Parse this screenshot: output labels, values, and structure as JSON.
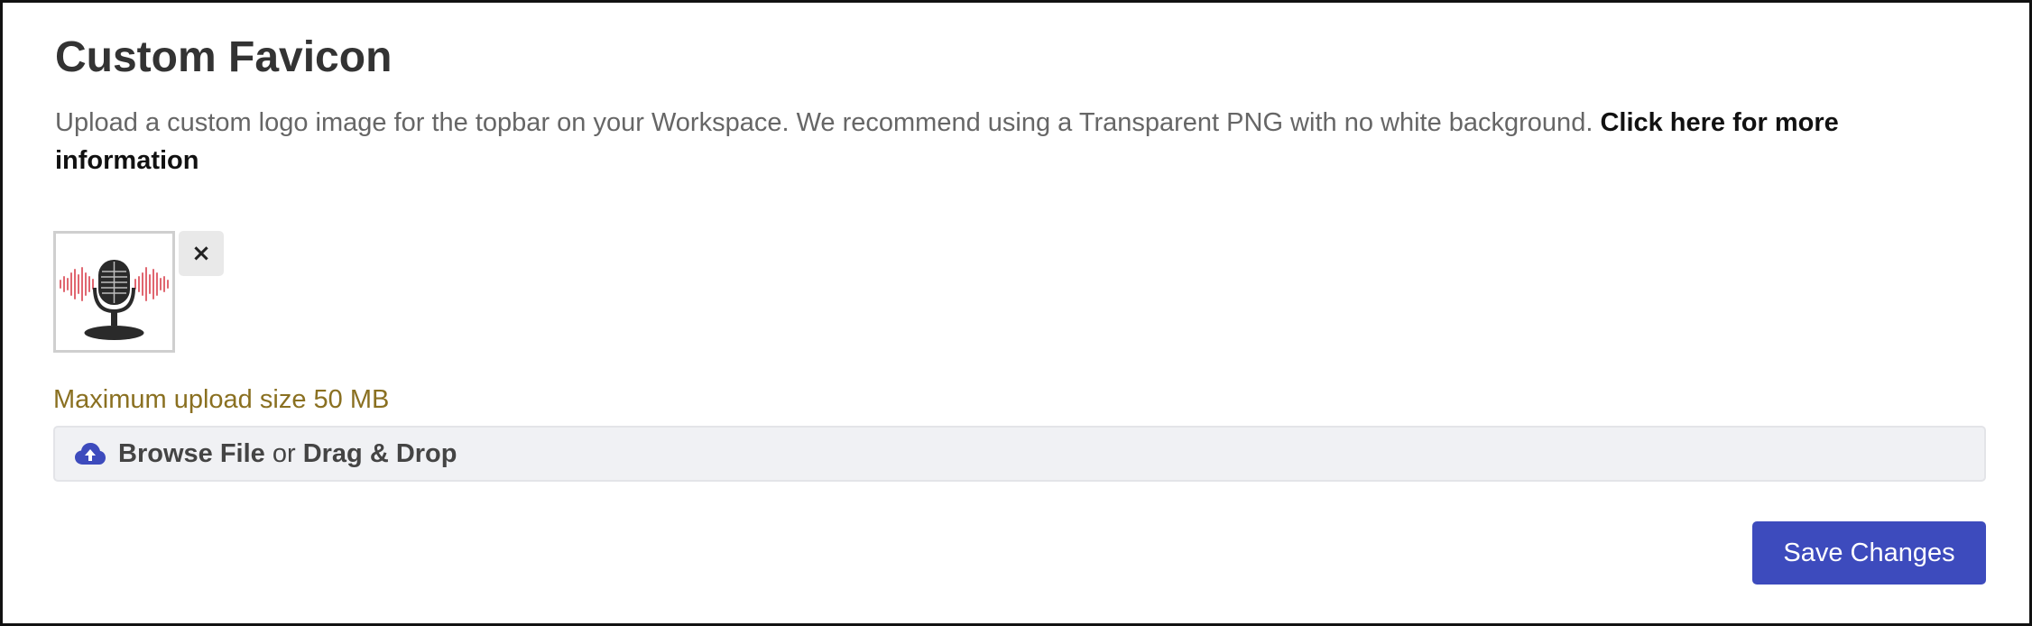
{
  "section": {
    "title": "Custom Favicon",
    "description": "Upload a custom logo image for the topbar on your Workspace. We recommend using a Transparent PNG with no white background.",
    "more_info_link": "Click here for more information"
  },
  "preview": {
    "image_icon": "microphone-soundwave-logo",
    "remove_label": "×",
    "remove_icon": "close-icon"
  },
  "upload": {
    "max_size_text": "Maximum upload size 50 MB",
    "icon": "cloud-upload-icon",
    "browse_label": "Browse File",
    "or_label": "or",
    "drag_label": "Drag & Drop"
  },
  "actions": {
    "save_label": "Save Changes"
  },
  "colors": {
    "primary": "#3d4bbd",
    "hint": "#8a7021",
    "dropzone_bg": "#f0f1f4",
    "soundwave": "#e06670"
  }
}
